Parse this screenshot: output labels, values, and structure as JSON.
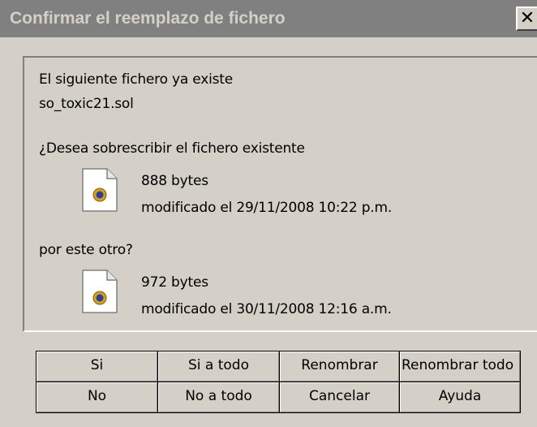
{
  "window": {
    "title": "Confirmar el reemplazo de fichero",
    "close_glyph": "✕"
  },
  "message": {
    "line1": "El siguiente fichero ya existe",
    "filename": "so_toxic21.sol",
    "question": "¿Desea sobrescribir el fichero existente",
    "replace_with": "por este otro?"
  },
  "existing_file": {
    "size": "888 bytes",
    "modified": "modificado el 29/11/2008 10:22 p.m.",
    "icon": "flash-shared-object-file-icon"
  },
  "new_file": {
    "size": "972 bytes",
    "modified": "modificado el 30/11/2008 12:16 a.m.",
    "icon": "flash-shared-object-file-icon"
  },
  "buttons": {
    "yes": "Si",
    "yes_to_all": "Si a todo",
    "rename": "Renombrar",
    "rename_all": "Renombrar todo",
    "no": "No",
    "no_to_all": "No a todo",
    "cancel": "Cancelar",
    "help": "Ayuda"
  },
  "colors": {
    "face": "#d4d0c8",
    "titlebar_inactive": "#808080",
    "title_text": "#d4d0c8"
  }
}
